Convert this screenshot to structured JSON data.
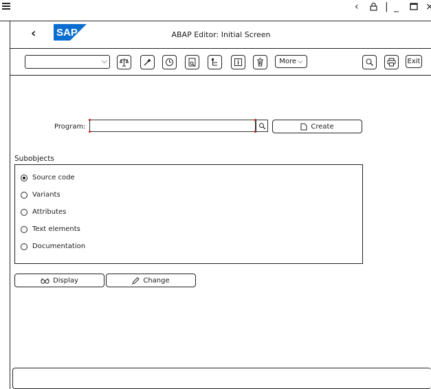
{
  "window": {
    "title": "ABAP Editor: Initial Screen"
  },
  "logo_text": "SAP",
  "toolbar": {
    "combo_value": "",
    "more_label": "More",
    "exit_label": "Exit"
  },
  "form": {
    "program_label": "Program:",
    "program_value": "",
    "create_label": "Create"
  },
  "subobjects": {
    "title": "Subobjects",
    "options": [
      {
        "label": "Source code",
        "selected": true
      },
      {
        "label": "Variants",
        "selected": false
      },
      {
        "label": "Attributes",
        "selected": false
      },
      {
        "label": "Text elements",
        "selected": false
      },
      {
        "label": "Documentation",
        "selected": false
      }
    ]
  },
  "actions": {
    "display_label": "Display",
    "change_label": "Change"
  },
  "colors": {
    "sap_blue": "#0a6ed1",
    "required_marker": "#d03b3b"
  }
}
